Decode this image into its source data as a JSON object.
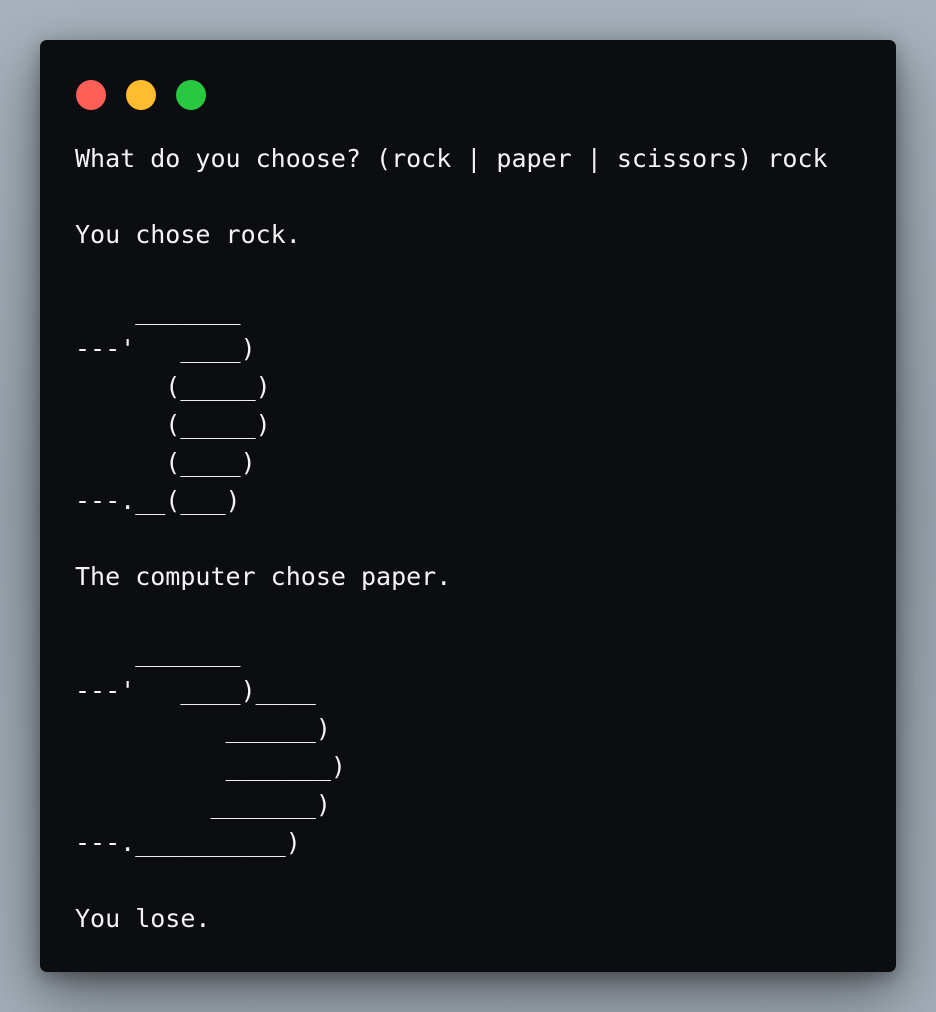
{
  "window": {
    "controls": [
      {
        "name": "close",
        "color": "#ff5f57"
      },
      {
        "name": "minimize",
        "color": "#febc2e"
      },
      {
        "name": "maximize",
        "color": "#28c840"
      }
    ]
  },
  "terminal": {
    "lines": [
      "What do you choose? (rock | paper | scissors) rock",
      "",
      "You chose rock.",
      "",
      "    _______",
      "---'   ____)",
      "      (_____)",
      "      (_____)",
      "      (____)",
      "---.__(___)",
      "",
      "The computer chose paper.",
      "",
      "    _______",
      "---'   ____)____",
      "          ______)",
      "          _______)",
      "         _______)",
      "---.__________)",
      "",
      "You lose."
    ]
  }
}
